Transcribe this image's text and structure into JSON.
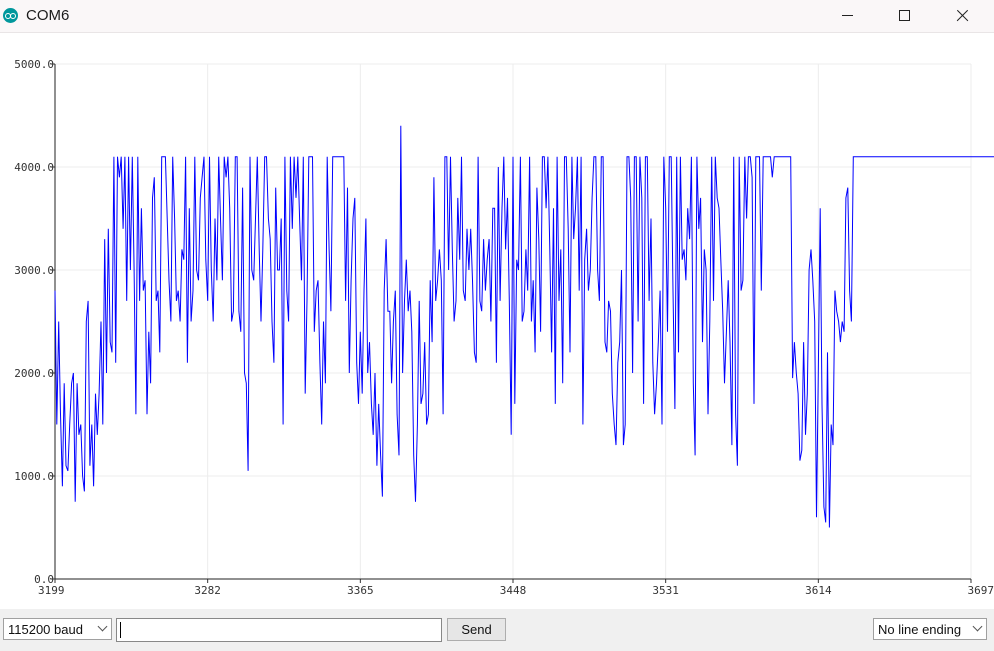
{
  "window": {
    "title": "COM6",
    "app_icon": "arduino-icon",
    "controls": [
      "minimize-icon",
      "maximize-icon",
      "close-icon"
    ]
  },
  "chart_data": {
    "type": "line",
    "x_ticks": [
      "3199",
      "3282",
      "3365",
      "3448",
      "3531",
      "3614",
      "3697"
    ],
    "y_ticks": [
      "0.0",
      "1000.0",
      "2000.0",
      "3000.0",
      "4000.0",
      "5000.0"
    ],
    "xlim": [
      3199,
      3697
    ],
    "ylim": [
      0,
      5000
    ],
    "grid": true,
    "series": [
      {
        "color": "#0000ff",
        "x_start": 3199,
        "x_step": 1,
        "values": [
          2800,
          1500,
          2500,
          1600,
          900,
          1900,
          1100,
          1050,
          1500,
          1900,
          2000,
          750,
          1900,
          1400,
          1500,
          1000,
          850,
          2500,
          2700,
          1100,
          1500,
          900,
          1800,
          1400,
          1800,
          2500,
          1500,
          3300,
          2000,
          3400,
          2300,
          2200,
          4100,
          2100,
          4100,
          3900,
          4100,
          3400,
          4100,
          2700,
          4100,
          3000,
          4100,
          3000,
          1600,
          4100,
          2700,
          3600,
          2800,
          2900,
          1600,
          2400,
          1900,
          3700,
          3900,
          2700,
          2800,
          2200,
          4100,
          4100,
          4100,
          3500,
          2900,
          2500,
          4100,
          3500,
          2700,
          2800,
          2500,
          3200,
          3100,
          4100,
          2100,
          3600,
          2500,
          2800,
          4100,
          3000,
          2900,
          3700,
          3900,
          4100,
          3100,
          2700,
          4100,
          3000,
          2500,
          3500,
          2900,
          4100,
          3500,
          2900,
          4100,
          3900,
          4100,
          3600,
          2500,
          2600,
          4100,
          4100,
          2600,
          2400,
          3800,
          2000,
          1900,
          1050,
          4100,
          3000,
          2900,
          3500,
          4100,
          3200,
          2500,
          3200,
          4100,
          4100,
          3500,
          3300,
          2500,
          2100,
          3800,
          3000,
          3000,
          3500,
          1500,
          4100,
          2800,
          2500,
          4100,
          3400,
          4100,
          3700,
          4100,
          3500,
          2900,
          4100,
          1800,
          2700,
          4100,
          4100,
          4100,
          2400,
          2800,
          2900,
          2100,
          1500,
          2500,
          1900,
          4100,
          3200,
          2600,
          4100,
          4100,
          4100,
          4100,
          4100,
          4100,
          4100,
          2700,
          3800,
          2000,
          2900,
          3500,
          3700,
          2100,
          1700,
          2400,
          1800,
          2800,
          3500,
          2000,
          2300,
          1700,
          1400,
          2000,
          1100,
          1700,
          1200,
          800,
          2800,
          3300,
          2600,
          2600,
          1900,
          2500,
          2800,
          1600,
          1200,
          4400,
          2000,
          2700,
          3100,
          2600,
          2800,
          2400,
          1200,
          750,
          1500,
          2700,
          1700,
          1800,
          2300,
          1500,
          1600,
          2900,
          2300,
          3900,
          2700,
          2900,
          3200,
          2900,
          1600,
          4100,
          4100,
          3000,
          4100,
          3200,
          2500,
          2700,
          3700,
          3100,
          4100,
          2800,
          2700,
          3400,
          3000,
          3400,
          2900,
          2200,
          2100,
          4100,
          2700,
          2600,
          3300,
          2800,
          3100,
          3300,
          2500,
          3600,
          3600,
          2100,
          4000,
          2700,
          3600,
          4100,
          3200,
          3700,
          2700,
          1400,
          4100,
          1700,
          3100,
          3000,
          4100,
          2500,
          2600,
          3200,
          2800,
          4100,
          2500,
          2900,
          2200,
          3800,
          3300,
          2400,
          4100,
          4100,
          3600,
          4100,
          3200,
          2200,
          3600,
          1700,
          4100,
          2700,
          3200,
          1900,
          4100,
          4100,
          3400,
          2200,
          4100,
          3300,
          3600,
          4100,
          2800,
          4100,
          1500,
          3100,
          3400,
          2800,
          3000,
          3700,
          4100,
          4100,
          3000,
          2700,
          4100,
          4100,
          2300,
          2200,
          2700,
          2600,
          1800,
          1500,
          1300,
          2100,
          2300,
          3000,
          1300,
          1500,
          4100,
          4100,
          3700,
          2000,
          4100,
          4100,
          2500,
          4100,
          3700,
          1700,
          4100,
          4100,
          2700,
          3500,
          2100,
          1600,
          1900,
          2300,
          2800,
          1500,
          4100,
          3600,
          2400,
          4100,
          4100,
          2800,
          1650,
          4100,
          2200,
          4100,
          3100,
          3200,
          2900,
          3600,
          3300,
          4100,
          1900,
          1200,
          4100,
          3400,
          3700,
          2300,
          3200,
          3000,
          1600,
          2500,
          4100,
          2700,
          4100,
          3700,
          3600,
          3100,
          2600,
          1900,
          2400,
          2900,
          2300,
          1300,
          4100,
          1600,
          1100,
          4100,
          2800,
          2900,
          4100,
          3500,
          4100,
          4100,
          3900,
          1700,
          4100,
          4100,
          4100,
          2800,
          4100,
          4100,
          4100,
          4100,
          4100,
          3900,
          4100,
          4100,
          4100,
          4100,
          4100,
          4100,
          4100,
          4100,
          4100,
          4100,
          1950,
          2300,
          2000,
          1800,
          1150,
          1250,
          2300,
          1400,
          1800,
          3000,
          3200,
          2900,
          2500,
          600,
          2000,
          3600,
          1700,
          700,
          550,
          2200,
          500,
          1500,
          1300,
          2800,
          2600,
          2500,
          2300,
          2500,
          2400,
          3700,
          3800,
          2800,
          2500,
          4100,
          4100,
          4100,
          4100,
          4100,
          4100,
          4100,
          4100,
          4100,
          4100,
          4100,
          4100,
          4100,
          4100,
          4100,
          4100,
          4100,
          4100,
          4100,
          4100,
          4100,
          4100,
          4100,
          4100,
          4100,
          4100,
          4100,
          4100,
          4100,
          4100,
          4100,
          4100,
          4100,
          4100,
          4100,
          4100,
          4100,
          4100,
          4100,
          4100,
          4100,
          4100,
          4100,
          4100,
          4100,
          4100,
          4100,
          4100,
          4100,
          4100,
          4100,
          4100,
          4100,
          4100,
          4100,
          4100,
          4100,
          4100,
          4100,
          4100,
          4100,
          4100,
          4100,
          4100,
          4100,
          4100,
          4100,
          4100,
          4100,
          4100,
          4100,
          4100,
          4100,
          4100,
          4100,
          4100,
          4100,
          4100,
          4100,
          4100,
          4100,
          4100,
          4100,
          4100,
          4100,
          4100,
          4100,
          4100,
          4100,
          4100,
          4100,
          4100,
          4100,
          4100,
          4100,
          4100,
          4100,
          4100,
          4100,
          4100,
          4100,
          4100,
          4100,
          4100,
          4100,
          4100,
          4100,
          4100,
          4100,
          4100,
          4100,
          4100,
          4100,
          4100,
          4100,
          4100,
          4100,
          4100,
          4100,
          4100,
          4100,
          4100,
          4100,
          4100,
          4100,
          4100
        ]
      }
    ]
  },
  "toolbar": {
    "baud_value": "115200 baud",
    "input_value": "",
    "send_label": "Send",
    "line_ending_value": "No line ending"
  }
}
